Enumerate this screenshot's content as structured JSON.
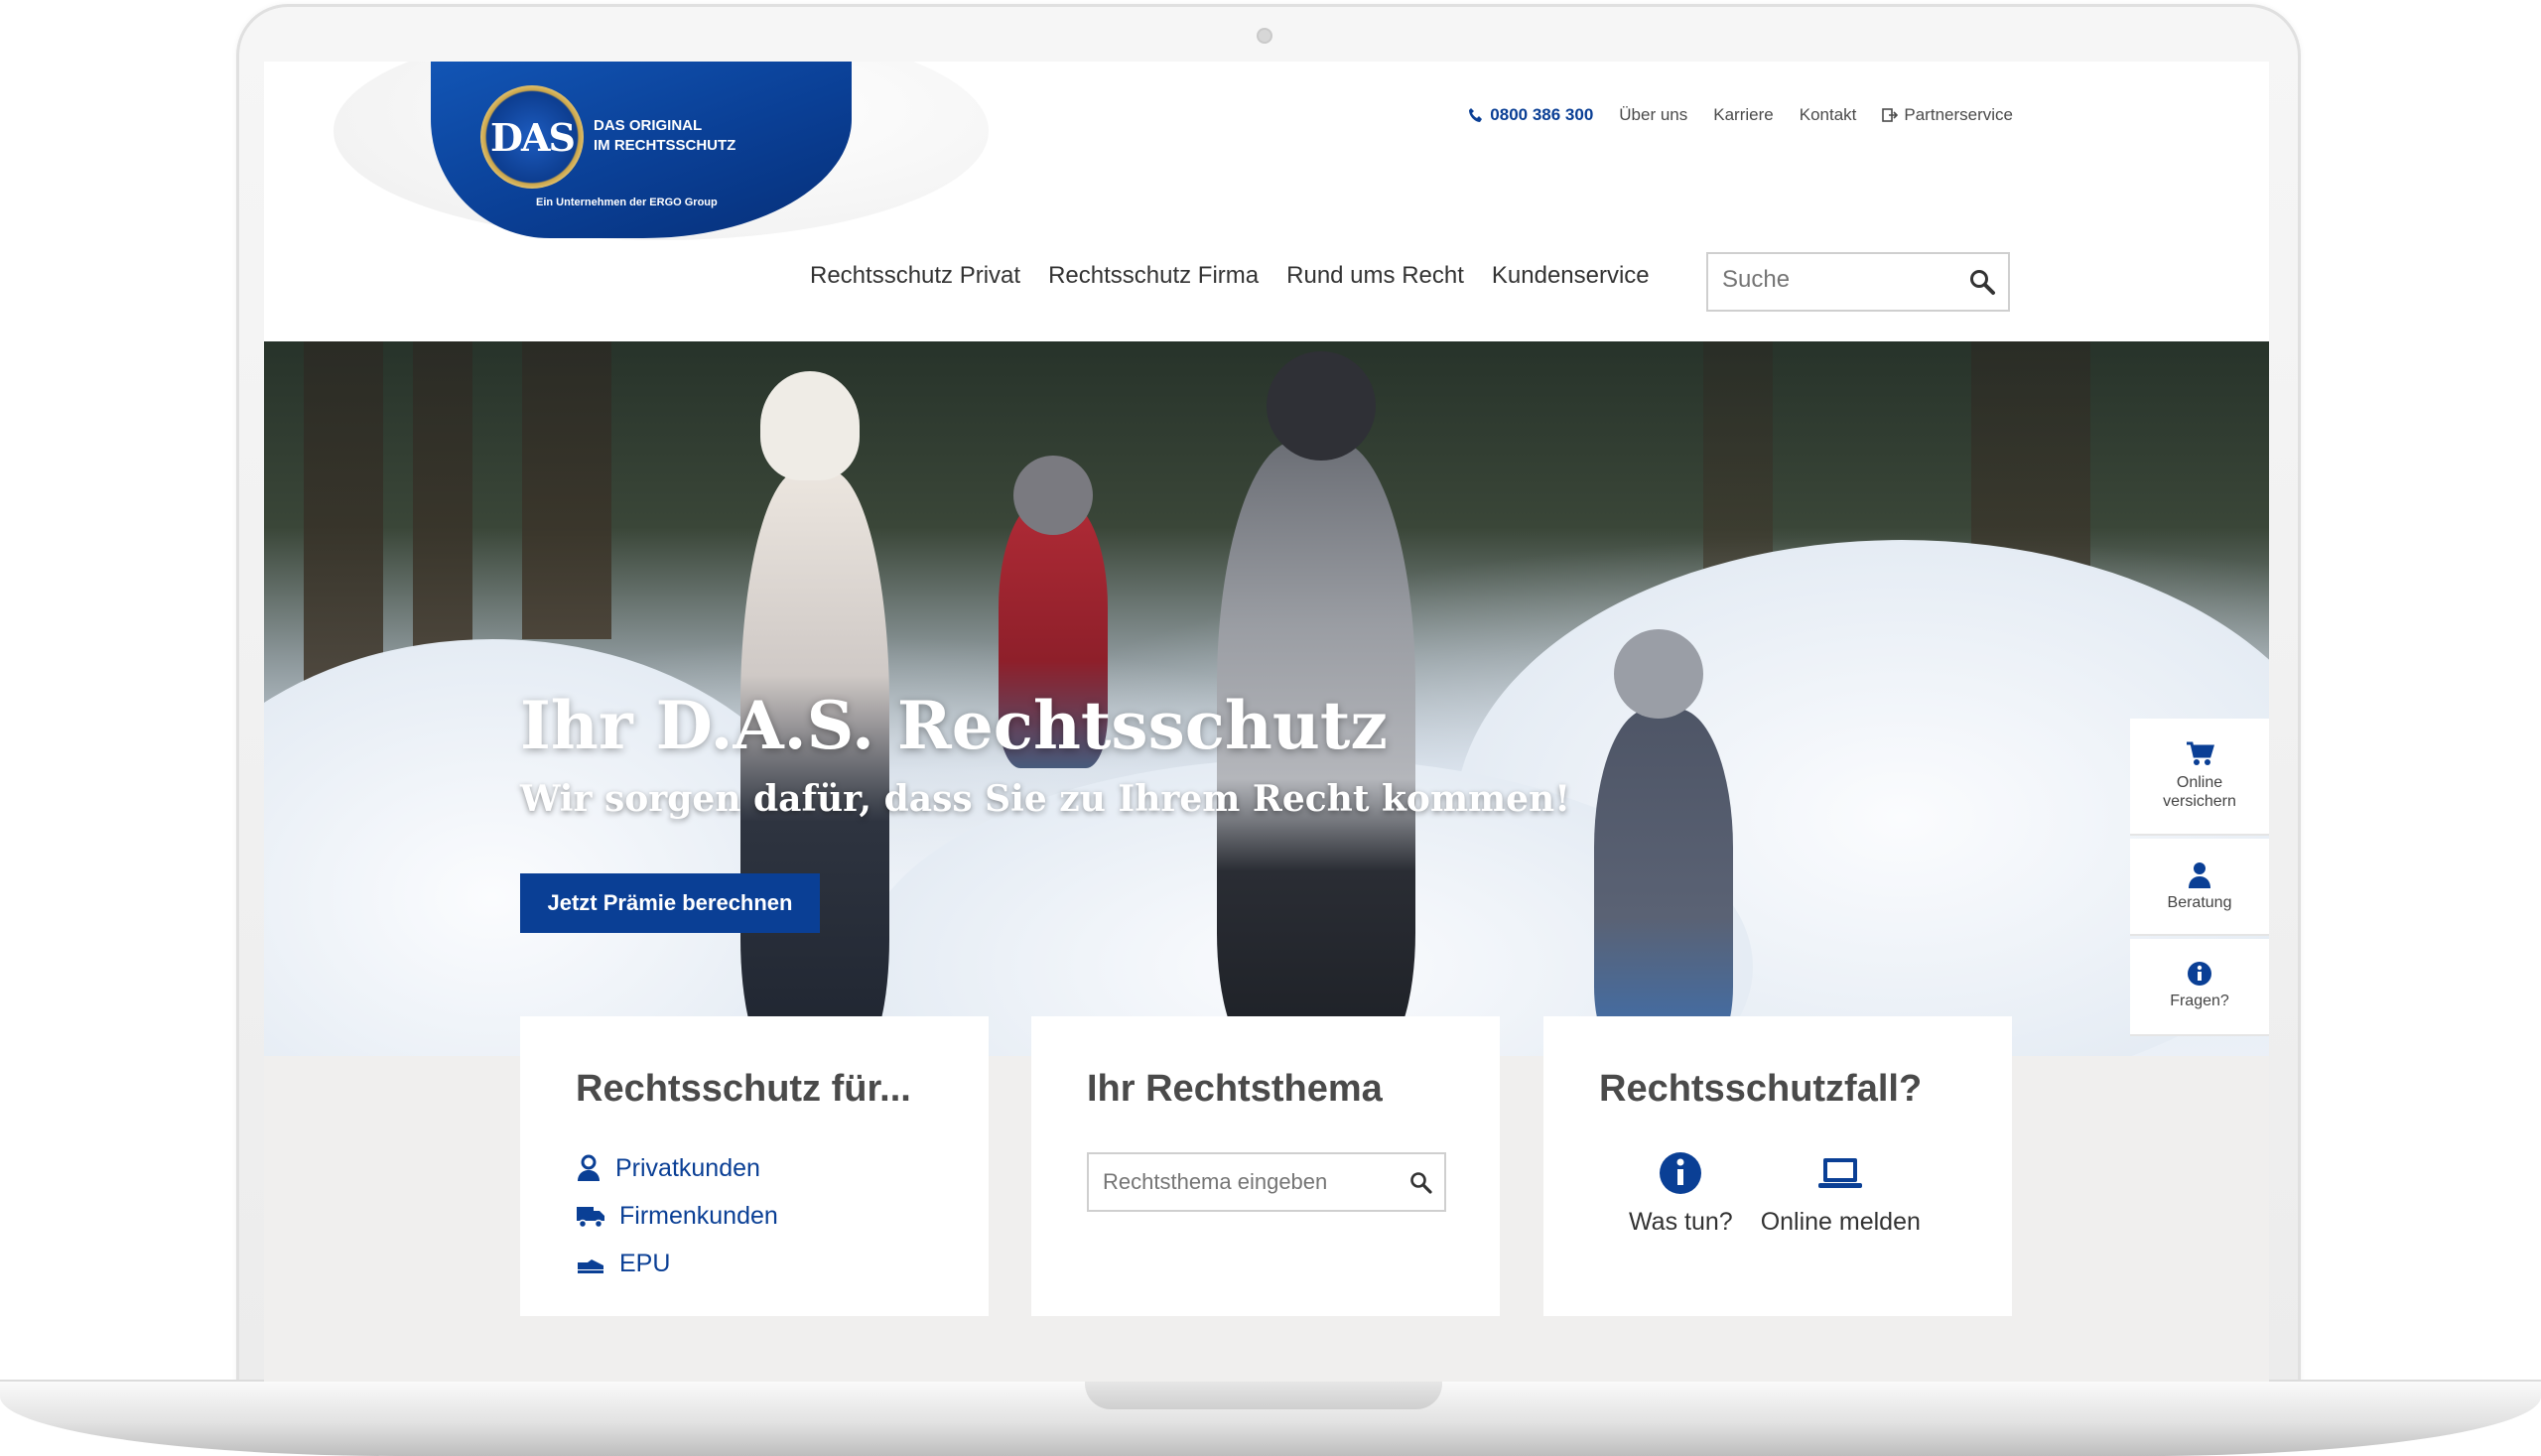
{
  "brand": {
    "logo_text": "DAS",
    "tagline_line1": "DAS ORIGINAL",
    "tagline_line2": "IM RECHTSSCHUTZ",
    "group_note": "Ein Unternehmen der ERGO Group",
    "primary_color": "#0a3f95"
  },
  "topnav": {
    "phone": "0800 386 300",
    "items": [
      "Über uns",
      "Karriere",
      "Kontakt"
    ],
    "partner": "Partnerservice"
  },
  "mainnav": {
    "items": [
      "Rechtsschutz Privat",
      "Rechtsschutz Firma",
      "Rund ums Recht",
      "Kundenservice"
    ]
  },
  "search": {
    "placeholder": "Suche"
  },
  "hero": {
    "title": "Ihr D.A.S. Rechtsschutz",
    "subtitle": "Wir sorgen dafür, dass Sie zu Ihrem Recht kommen!",
    "cta": "Jetzt Prämie berechnen"
  },
  "sidebar": {
    "items": [
      {
        "label1": "Online",
        "label2": "versichern",
        "icon": "cart-icon"
      },
      {
        "label1": "Beratung",
        "label2": "",
        "icon": "person-icon"
      },
      {
        "label1": "Fragen?",
        "label2": "",
        "icon": "info-icon"
      }
    ]
  },
  "cards": {
    "card1": {
      "title": "Rechtsschutz für...",
      "links": [
        "Privatkunden",
        "Firmenkunden",
        "EPU"
      ]
    },
    "card2": {
      "title": "Ihr Rechtsthema",
      "placeholder": "Rechtsthema eingeben"
    },
    "card3": {
      "title": "Rechtsschutzfall?",
      "actions": [
        "Was tun?",
        "Online melden"
      ]
    }
  }
}
